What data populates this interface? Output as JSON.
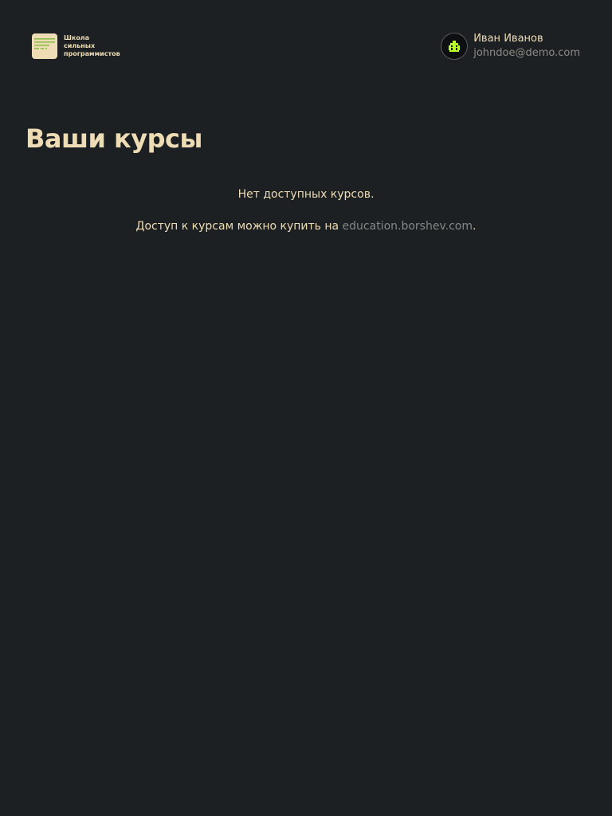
{
  "logo": {
    "lines": [
      "Школа",
      "сильных",
      "программистов"
    ],
    "icon": "text-lines-icon",
    "icon_bg": "#eddcb4",
    "icon_fg": "#8bbf4a"
  },
  "user": {
    "name": "Иван Иванов",
    "email": "johndoe@demo.com",
    "avatar_icon": "pixel-creature-icon",
    "avatar_color": "#b6ff2a"
  },
  "main": {
    "title": "Ваши курсы",
    "empty_message": "Нет доступных курсов.",
    "purchase_prefix": "Доступ к курсам можно купить на ",
    "purchase_link": "education.borshev.com",
    "purchase_suffix": "."
  },
  "colors": {
    "background": "#1d2022",
    "text": "#eddcb4",
    "muted": "#8a8c86",
    "link": "#7f8a86"
  }
}
